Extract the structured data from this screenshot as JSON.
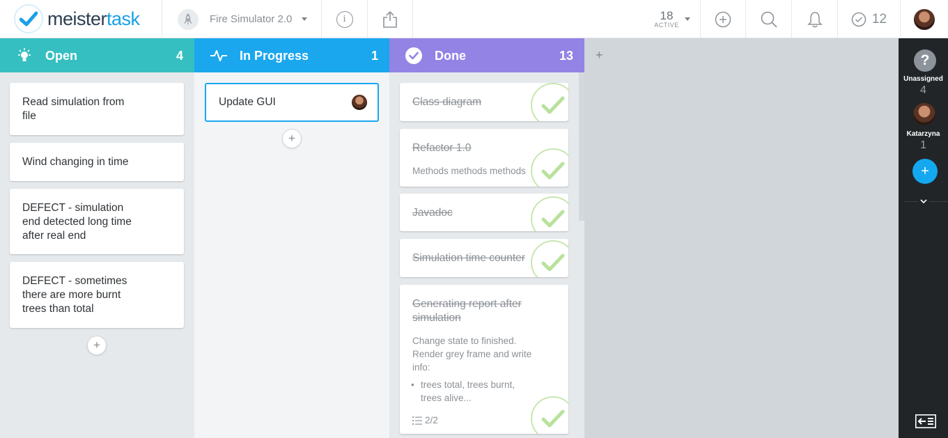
{
  "app": {
    "logo_text_a": "meister",
    "logo_text_b": "task"
  },
  "project": {
    "name": "Fire Simulator 2.0"
  },
  "topbar": {
    "active_count": "18",
    "active_label": "ACTIVE",
    "my_tasks_count": "12",
    "info_glyph": "i"
  },
  "colors": {
    "open": "#36bfc1",
    "in_progress": "#1aa7ee",
    "done": "#9283e5",
    "accent": "#13a8f0"
  },
  "columns": {
    "open": {
      "title": "Open",
      "count": "4",
      "cards": [
        {
          "title_lines": [
            "Read simulation from",
            "file"
          ]
        },
        {
          "title_lines": [
            "Wind changing in time"
          ]
        },
        {
          "title_lines": [
            "DEFECT - simulation",
            "end detected long time",
            "after real end"
          ]
        },
        {
          "title_lines": [
            "DEFECT - sometimes",
            "there are more burnt",
            "trees than total"
          ]
        }
      ],
      "add_label": "+"
    },
    "in_progress": {
      "title": "In Progress",
      "count": "1",
      "cards": [
        {
          "title": "Update GUI"
        }
      ],
      "add_label": "+"
    },
    "done": {
      "title": "Done",
      "count": "13",
      "cards": [
        {
          "title_lines": [
            "Class diagram"
          ]
        },
        {
          "title_lines": [
            "Refactor 1.0"
          ],
          "desc": "Methods methods methods"
        },
        {
          "title_lines": [
            "Javadoc"
          ]
        },
        {
          "title_lines": [
            "Simulation time counter"
          ]
        },
        {
          "title_lines": [
            "Generating report after",
            "simulation"
          ],
          "desc_lines": [
            "Change state to finished.",
            "Render grey frame and write",
            "info:"
          ],
          "bullet_lines": [
            "trees total, trees burnt,",
            "trees alive..."
          ],
          "checklist": "2/2"
        }
      ]
    }
  },
  "add_column_label": "+",
  "sidebar": {
    "unassigned_label": "Unassigned",
    "unassigned_count": "4",
    "unassigned_glyph": "?",
    "user_label": "Katarzyna",
    "user_count": "1",
    "add_label": "+"
  }
}
